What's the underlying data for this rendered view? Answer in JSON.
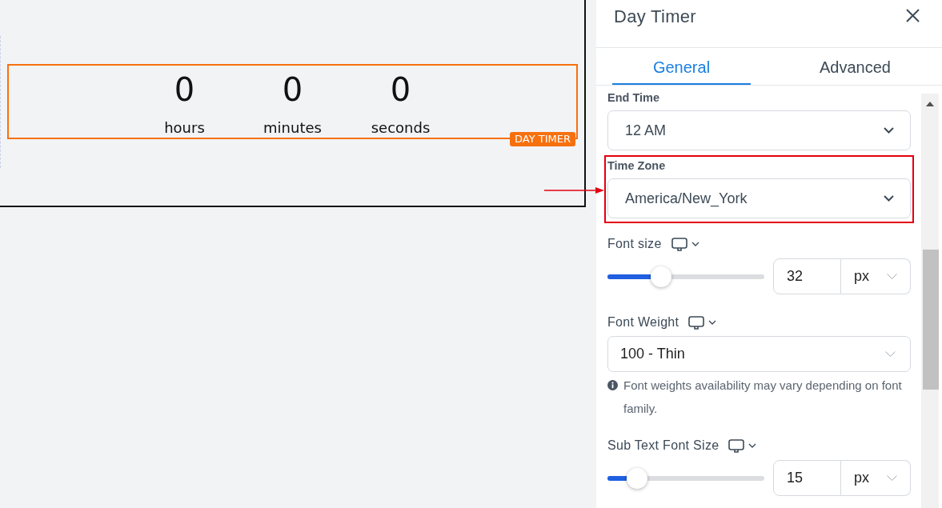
{
  "canvas": {
    "timer": {
      "units": [
        {
          "value": "0",
          "label": "hours"
        },
        {
          "value": "0",
          "label": "minutes"
        },
        {
          "value": "0",
          "label": "seconds"
        }
      ],
      "badge": "DAY TIMER"
    }
  },
  "panel": {
    "title": "Day Timer",
    "tabs": [
      {
        "label": "General",
        "selected": true
      },
      {
        "label": "Advanced",
        "selected": false
      }
    ],
    "fields": [
      {
        "kind": "select",
        "label": "End Time",
        "value": "12 AM",
        "highlighted": false,
        "device_toggle": false
      },
      {
        "kind": "select",
        "label": "Time Zone",
        "value": "America/New_York",
        "highlighted": true,
        "device_toggle": false
      },
      {
        "kind": "slider",
        "label": "Font size",
        "level": 0.34,
        "value": "32",
        "unit": "px",
        "highlighted": false,
        "device_toggle": true
      },
      {
        "kind": "font-select",
        "label": "Font Weight",
        "value": "100 - Thin",
        "note": "Font weights availability may vary depending on font family.",
        "highlighted": false,
        "device_toggle": true
      },
      {
        "kind": "slider",
        "label": "Sub Text Font Size",
        "level": 0.19,
        "value": "15",
        "unit": "px",
        "highlighted": false,
        "device_toggle": true
      }
    ]
  }
}
